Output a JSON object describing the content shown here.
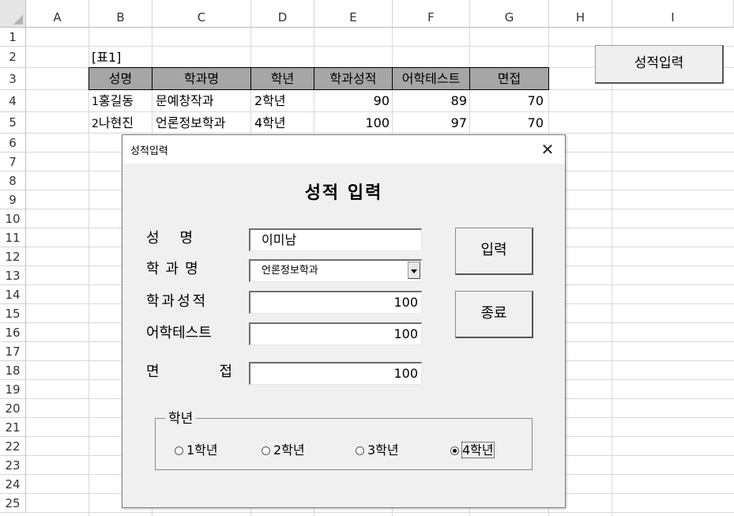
{
  "columns": [
    "A",
    "B",
    "C",
    "D",
    "E",
    "F",
    "G",
    "H",
    "I"
  ],
  "rows": [
    "1",
    "2",
    "3",
    "4",
    "5",
    "6",
    "7",
    "8",
    "9",
    "10",
    "11",
    "12",
    "13",
    "14",
    "15",
    "16",
    "17",
    "18",
    "19",
    "20",
    "21",
    "22",
    "23",
    "24",
    "25"
  ],
  "sheet": {
    "table_label": "[표1]",
    "headers": [
      "성명",
      "학과명",
      "학년",
      "학과성적",
      "어학테스트",
      "면접"
    ],
    "records": [
      {
        "no": "1",
        "name": "홍길동",
        "dept": "문예창작과",
        "grade": "2학년",
        "score": "90",
        "lang": "89",
        "interview": "70"
      },
      {
        "no": "2",
        "name": "나현진",
        "dept": "언론정보학과",
        "grade": "4학년",
        "score": "100",
        "lang": "97",
        "interview": "70"
      }
    ],
    "open_form_button": "성적입력"
  },
  "dialog": {
    "title": "성적입력",
    "close_glyph": "✕",
    "heading": "성적 입력",
    "labels": {
      "name": "성명",
      "dept": "학과명",
      "score": "학과성적",
      "lang": "어학테스트",
      "interview": "면접"
    },
    "values": {
      "name": "이미남",
      "dept": "언론정보학과",
      "score": "100",
      "lang": "100",
      "interview": "100"
    },
    "buttons": {
      "submit": "입력",
      "exit": "종료"
    },
    "grade_frame": {
      "label": "학년",
      "options": [
        "1학년",
        "2학년",
        "3학년",
        "4학년"
      ],
      "selected": "4학년"
    }
  }
}
